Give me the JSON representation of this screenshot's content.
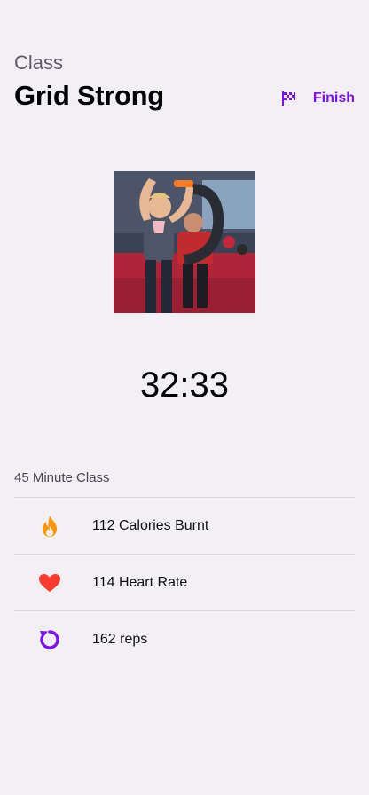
{
  "header": {
    "eyebrow": "Class",
    "title": "Grid Strong",
    "finish_label": "Finish"
  },
  "timer": "32:33",
  "class_length_label": "45 Minute Class",
  "stats": [
    {
      "icon": "flame-icon",
      "text": "112 Calories Burnt",
      "color": "#ff9500"
    },
    {
      "icon": "heart-icon",
      "text": "114 Heart Rate",
      "color": "#ff3b30"
    },
    {
      "icon": "refresh-icon",
      "text": "162 reps",
      "color": "#7a12f0"
    }
  ],
  "colors": {
    "accent": "#7a12f0",
    "background": "#f2f0f5"
  }
}
